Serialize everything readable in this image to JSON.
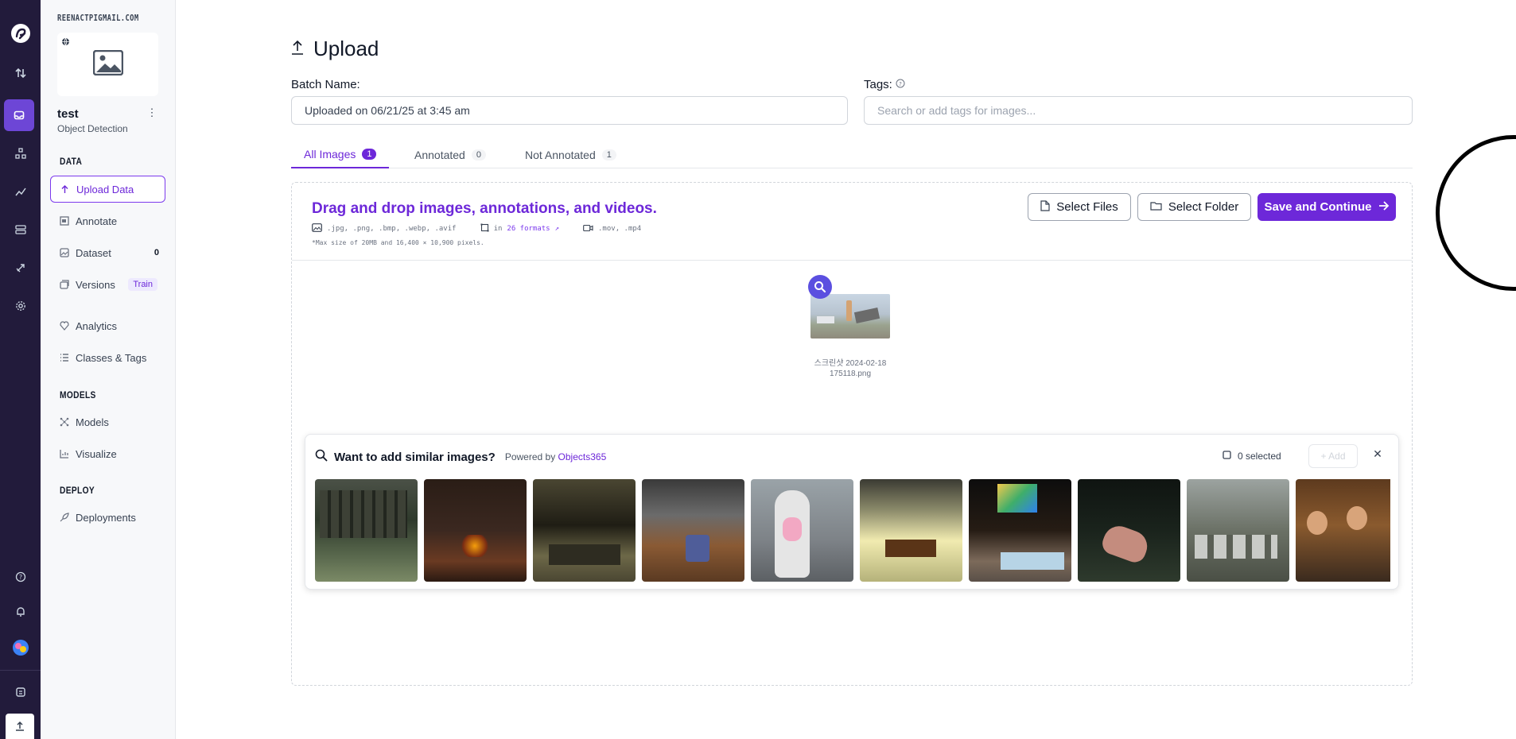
{
  "workspace": "REENACTPIGMAIL.COM",
  "project": {
    "name": "test",
    "type": "Object Detection"
  },
  "sections": {
    "data": "DATA",
    "models": "MODELS",
    "deploy": "DEPLOY"
  },
  "nav": {
    "upload": "Upload Data",
    "annotate": "Annotate",
    "dataset": "Dataset",
    "dataset_count": "0",
    "versions": "Versions",
    "versions_badge": "Train",
    "analytics": "Analytics",
    "classes": "Classes & Tags",
    "models": "Models",
    "visualize": "Visualize",
    "deployments": "Deployments"
  },
  "page": {
    "title": "Upload"
  },
  "form": {
    "batch_label": "Batch Name:",
    "batch_value": "Uploaded on 06/21/25 at 3:45 am",
    "tags_label": "Tags:",
    "tags_placeholder": "Search or add tags for images..."
  },
  "tabs": [
    {
      "label": "All Images",
      "count": "1"
    },
    {
      "label": "Annotated",
      "count": "0"
    },
    {
      "label": "Not Annotated",
      "count": "1"
    }
  ],
  "dropzone": {
    "title": "Drag and drop images, annotations, and videos.",
    "image_formats": ".jpg, .png, .bmp, .webp, .avif",
    "annot_prefix": "in",
    "annot_link": "26 formats",
    "video_formats": ".mov, .mp4",
    "max_size": "*Max size of 20MB and 16,400 × 10,900 pixels.",
    "select_files": "Select Files",
    "select_folder": "Select Folder",
    "save": "Save and Continue"
  },
  "file": {
    "line1": "스크린샷 2024-02-18",
    "line2": "175118.png"
  },
  "similar": {
    "question": "Want to add similar images?",
    "powered": "Powered by",
    "source": "Objects365",
    "selected": "0 selected",
    "add": "+ Add"
  },
  "colors": {
    "accent": "#6d28d9",
    "rail": "#221b3b",
    "highlight_circle": "#000000"
  }
}
